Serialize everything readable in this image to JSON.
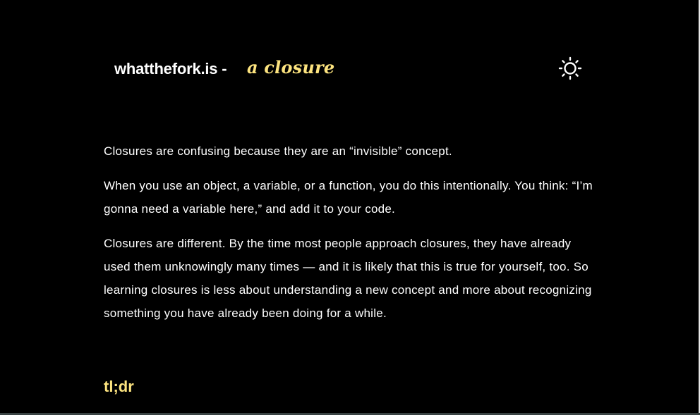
{
  "header": {
    "site_name": "whatthefork.is -",
    "topic": "a closure",
    "theme_toggle_icon": "sun-icon"
  },
  "article": {
    "paragraphs": [
      "Closures are confusing because they are an “invisible” concept.",
      "When you use an object, a variable, or a function, you do this intentionally. You think: “I’m gonna need a variable here,” and add it to your code.",
      "Closures are different. By the time most people approach closures, they have already used them unknowingly many times — and it is likely that this is true for yourself, too. So learning closures is less about understanding a new concept and more about recognizing something you have already been doing for a while."
    ],
    "section_heading": "tl;dr"
  },
  "colors": {
    "background": "#000000",
    "text": "#ffffff",
    "accent": "#fde47f"
  }
}
